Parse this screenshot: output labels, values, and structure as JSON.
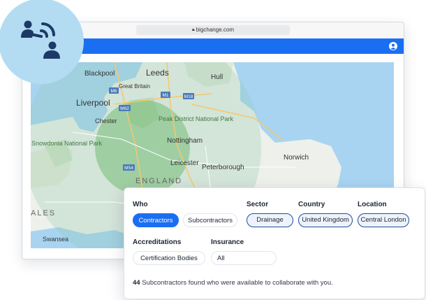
{
  "browser": {
    "url": "bigchange.com"
  },
  "map": {
    "places": [
      "Blackpool",
      "Leeds",
      "Hull",
      "Liverpool",
      "Great Britain",
      "Peak District National Park",
      "Chester",
      "Nottingham",
      "Snowdonia National Park",
      "Norwich",
      "Leicester",
      "Peterborough",
      "ENGLAND",
      "ALES",
      "Swansea"
    ],
    "roads": [
      "M6",
      "M1",
      "M18",
      "M62",
      "M54"
    ]
  },
  "filters": {
    "who": {
      "label": "Who",
      "options": [
        "Contractors",
        "Subcontractors"
      ]
    },
    "sector": {
      "label": "Sector",
      "value": "Drainage"
    },
    "country": {
      "label": "Country",
      "value": "United Kingdom"
    },
    "location": {
      "label": "Location",
      "value": "Central London"
    },
    "accreditations": {
      "label": "Accreditations",
      "value": "Certification Bodies"
    },
    "insurance": {
      "label": "Insurance",
      "value": "All"
    }
  },
  "result": {
    "count": "44",
    "text": "Subcontractors found who were available to collaborate with you."
  },
  "colors": {
    "accent": "#1a6ef2",
    "sea": "#a8d4f1",
    "land": "#eef0eb",
    "radius": "#9bcd9a"
  }
}
